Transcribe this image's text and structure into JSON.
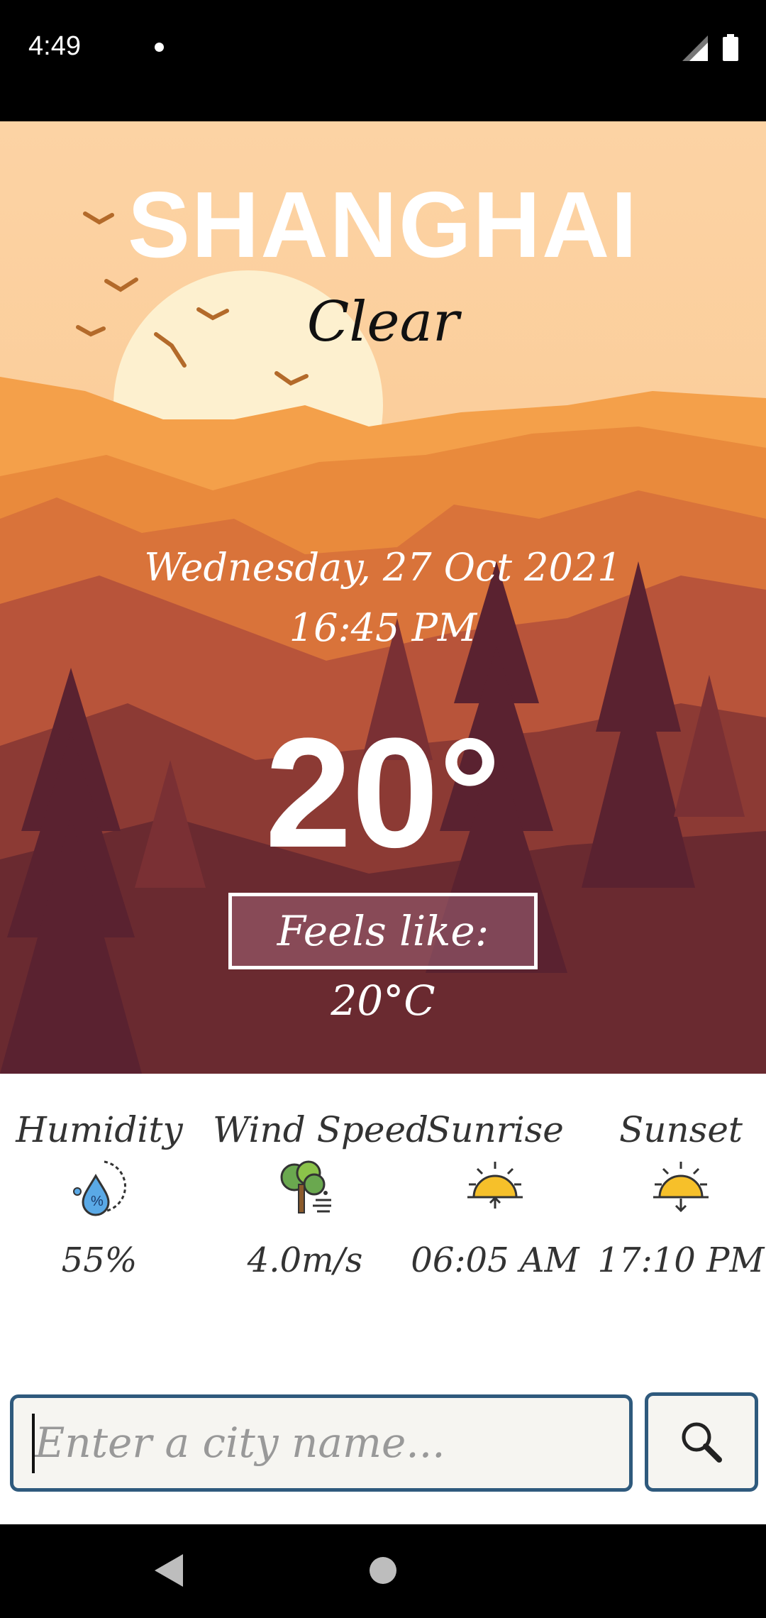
{
  "status_bar": {
    "time": "4:49"
  },
  "weather": {
    "city": "SHANGHAI",
    "condition": "Clear",
    "date": "Wednesday, 27 Oct 2021",
    "time": "16:45 PM",
    "temperature": "20°",
    "feels_like": "Feels like: 20°C"
  },
  "stats": [
    {
      "label": "Humidity",
      "icon": "humidity-icon",
      "value": "55%"
    },
    {
      "label": "Wind Speed",
      "icon": "tree-wind-icon",
      "value": "4.0m/s"
    },
    {
      "label": "Sunrise",
      "icon": "sunrise-icon",
      "value": "06:05 AM"
    },
    {
      "label": "Sunset",
      "icon": "sunset-icon",
      "value": "17:10 PM"
    }
  ],
  "search": {
    "placeholder": "Enter a city name...",
    "value": ""
  },
  "colors": {
    "sky": "#fcd3a4",
    "accent_border": "#2f5a7d",
    "input_bg": "#f6f5f1"
  }
}
